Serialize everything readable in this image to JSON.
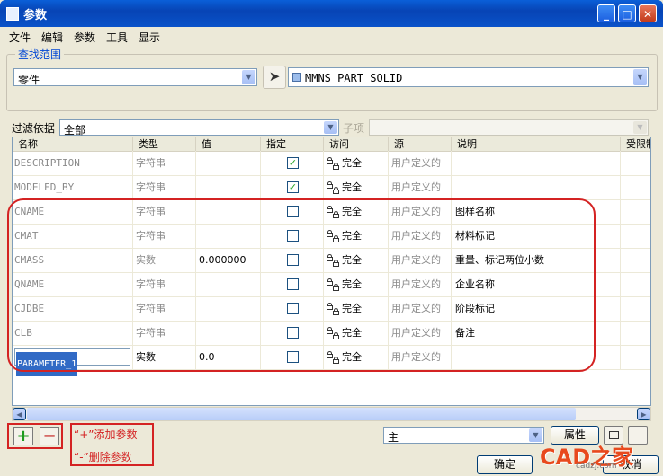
{
  "window": {
    "title": "参数"
  },
  "menu": [
    "文件",
    "编辑",
    "参数",
    "工具",
    "显示"
  ],
  "scope": {
    "label": "查找范围",
    "type_value": "零件",
    "object_value": "MMNS_PART_SOLID"
  },
  "filter": {
    "label": "过滤依据",
    "value": "全部",
    "sub_label": "子项",
    "sub_value": ""
  },
  "table": {
    "headers": [
      "名称",
      "类型",
      "值",
      "指定",
      "访问",
      "源",
      "说明",
      "受限制"
    ],
    "rows": [
      {
        "name": "DESCRIPTION",
        "type": "字符串",
        "value": "",
        "designated": true,
        "access": "完全",
        "source": "用户定义的",
        "desc": ""
      },
      {
        "name": "MODELED_BY",
        "type": "字符串",
        "value": "",
        "designated": true,
        "access": "完全",
        "source": "用户定义的",
        "desc": ""
      },
      {
        "name": "CNAME",
        "type": "字符串",
        "value": "",
        "designated": false,
        "access": "完全",
        "source": "用户定义的",
        "desc": "图样名称"
      },
      {
        "name": "CMAT",
        "type": "字符串",
        "value": "",
        "designated": false,
        "access": "完全",
        "source": "用户定义的",
        "desc": "材料标记"
      },
      {
        "name": "CMASS",
        "type": "实数",
        "value": "0.000000",
        "designated": false,
        "access": "完全",
        "source": "用户定义的",
        "desc": "重量、标记两位小数"
      },
      {
        "name": "QNAME",
        "type": "字符串",
        "value": "",
        "designated": false,
        "access": "完全",
        "source": "用户定义的",
        "desc": "企业名称"
      },
      {
        "name": "CJDBE",
        "type": "字符串",
        "value": "",
        "designated": false,
        "access": "完全",
        "source": "用户定义的",
        "desc": "阶段标记"
      },
      {
        "name": "CLB",
        "type": "字符串",
        "value": "",
        "designated": false,
        "access": "完全",
        "source": "用户定义的",
        "desc": "备注"
      },
      {
        "name": "PARAMETER_1",
        "type": "实数",
        "value": "0.0",
        "designated": false,
        "access": "完全",
        "source": "用户定义的",
        "desc": ""
      }
    ]
  },
  "notes": {
    "add": "“+”添加参数",
    "remove": "“-”删除参数"
  },
  "bottom": {
    "view_value": "主",
    "properties": "属性",
    "ok": "确定",
    "cancel": "取消"
  },
  "watermark": {
    "logo": "CAD之家",
    "sub": "cadzj.com"
  },
  "colors": {
    "accent_red": "#d42323",
    "checkmark_green": "#21a121"
  }
}
